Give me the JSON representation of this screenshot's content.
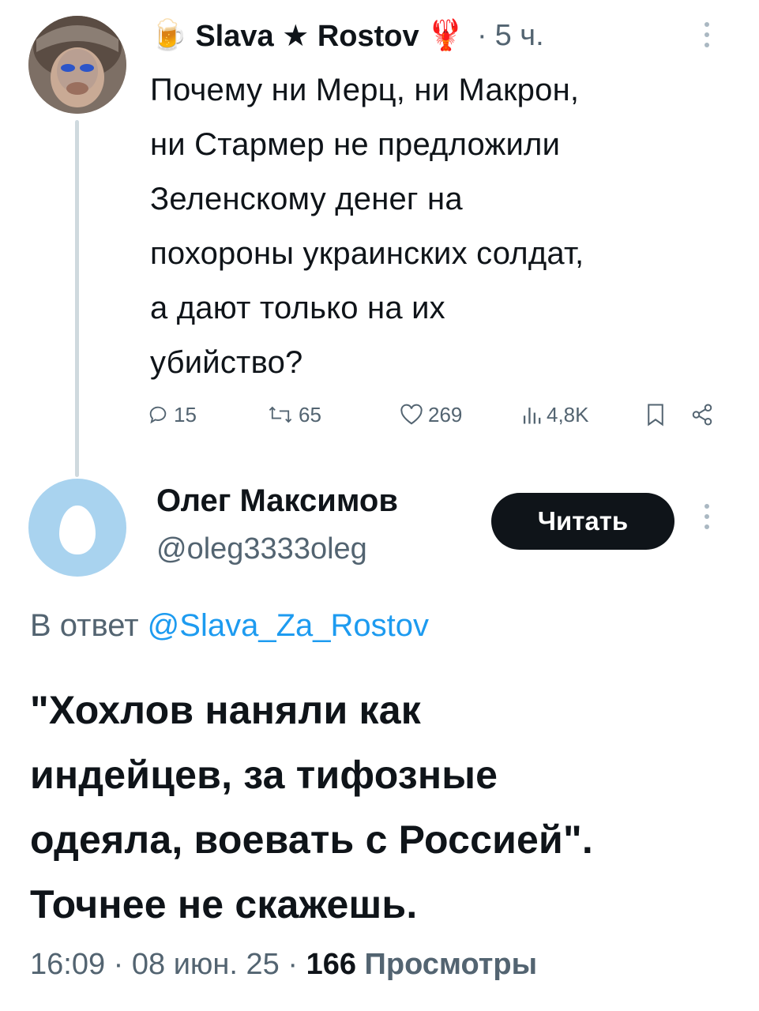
{
  "parent_tweet": {
    "author_prefix_emoji": "🍺",
    "author_name": "Slava ★ Rostov",
    "author_suffix_emoji": "🦞",
    "separator": "·",
    "time": "5 ч.",
    "text_lines": [
      "Почему ни Мерц, ни Макрон,",
      "ни Стармер не предложили",
      "Зеленскому денег на",
      "похороны украинских солдат,",
      "а дают только на их",
      "убийство?"
    ],
    "actions": {
      "replies": "15",
      "reposts": "65",
      "likes": "269",
      "views": "4,8K"
    }
  },
  "reply_tweet": {
    "author_name": "Олег Максимов",
    "author_handle": "@oleg3333oleg",
    "follow_label": "Читать",
    "reply_to_prefix": "В ответ",
    "reply_to_handle": "@Slava_Za_Rostov",
    "text_lines": [
      "\"Хохлов наняли как",
      "индейцев, за тифозные",
      "одеяла, воевать с Россией\".",
      "Точнее не скажешь."
    ],
    "time": "16:09",
    "date": "08 июн. 25",
    "separator": "·",
    "views_count": "166",
    "views_label": "Просмотры"
  },
  "colors": {
    "text": "#0f1419",
    "secondary": "#536471",
    "link": "#1d9bf0",
    "thread_line": "#cfd9de",
    "egg_avatar_bg": "#a9d3ef"
  }
}
